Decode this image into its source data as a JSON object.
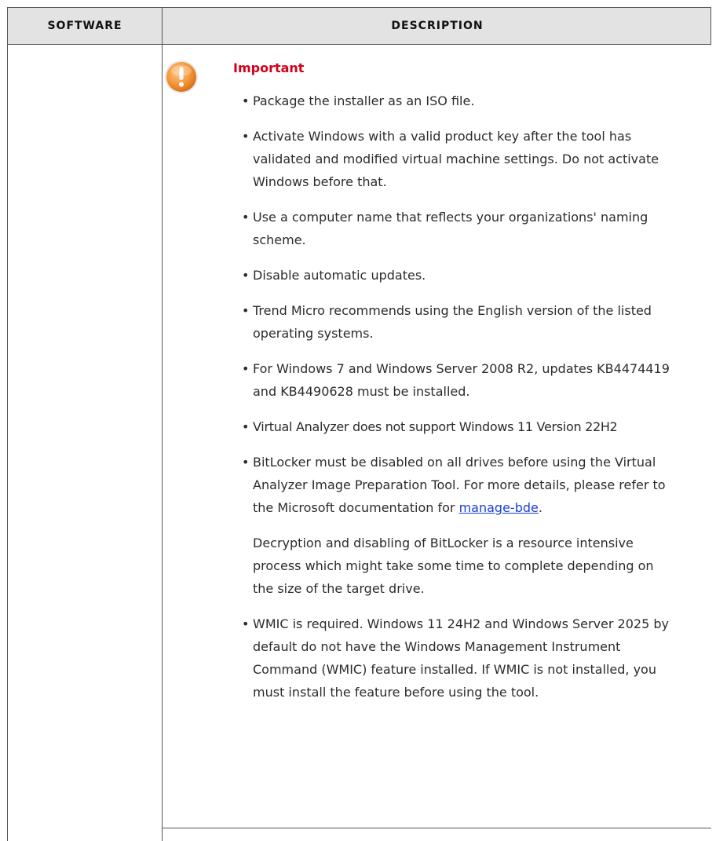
{
  "table": {
    "headers": {
      "software": "Software",
      "description": "Description"
    }
  },
  "note": {
    "label": "Important",
    "icon": "warning-icon",
    "items": [
      {
        "text": "Package the installer as an ISO file."
      },
      {
        "text": "Activate Windows with a valid product key after the tool has validated and modified virtual machine settings. Do not activate Windows before that."
      },
      {
        "text": "Use a computer name that reflects your organizations' naming scheme."
      },
      {
        "text": "Disable automatic updates."
      },
      {
        "text": "Trend Micro recommends using the English version of the listed operating systems."
      },
      {
        "text": "For Windows 7 and Windows Server 2008 R2, updates KB4474419 and KB4490628 must be installed."
      },
      {
        "text": "Virtual Analyzer does not support Windows 11 Version 22H2"
      },
      {
        "text_before_link": "BitLocker must be disabled on all drives before using the Virtual Analyzer Image Preparation Tool. For more details, please refer to the Microsoft documentation for ",
        "link": "manage-bde",
        "text_after_link": ".",
        "extra": "Decryption and disabling of BitLocker is a resource intensive process which might take some time to complete depending on the size of the target drive."
      },
      {
        "text": "WMIC is required. Windows 11 24H2 and Windows Server 2025 by default do not have the Windows Management Instrument Command (WMIC) feature installed. If WMIC is not installed, you must install the feature before using the tool."
      }
    ]
  },
  "colors": {
    "important": "#d4001a",
    "link": "#1a3fd6",
    "header_bg": "#e3e3e3",
    "icon": "#f08a24"
  }
}
